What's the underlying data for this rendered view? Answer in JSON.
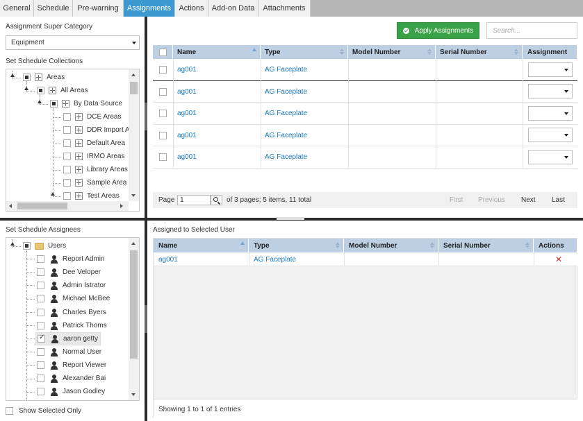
{
  "tabs": [
    {
      "label": "General",
      "active": false
    },
    {
      "label": "Schedule",
      "active": false
    },
    {
      "label": "Pre-warning",
      "active": false
    },
    {
      "label": "Assignments",
      "active": true
    },
    {
      "label": "Actions",
      "active": false
    },
    {
      "label": "Add-on Data",
      "active": false
    },
    {
      "label": "Attachments",
      "active": false
    }
  ],
  "left_top": {
    "super_category_label": "Assignment Super Category",
    "super_category_value": "Equipment",
    "collections_label": "Set Schedule Collections",
    "tree": [
      {
        "label": "Areas",
        "state": "partial",
        "icon": "grid-icon"
      },
      {
        "label": "All Areas",
        "state": "partial",
        "icon": "grid-icon"
      },
      {
        "label": "By Data Source",
        "state": "partial",
        "icon": "grid-icon"
      },
      {
        "label": "DCE Areas",
        "state": "unchecked",
        "icon": "grid-icon"
      },
      {
        "label": "DDR Import A",
        "state": "unchecked",
        "icon": "grid-icon"
      },
      {
        "label": "Default Area",
        "state": "unchecked",
        "icon": "grid-icon"
      },
      {
        "label": "IRMO Areas",
        "state": "unchecked",
        "icon": "grid-icon"
      },
      {
        "label": "Library Areas",
        "state": "unchecked",
        "icon": "grid-icon"
      },
      {
        "label": "Sample Area",
        "state": "unchecked",
        "icon": "grid-icon"
      },
      {
        "label": "Test Areas",
        "state": "unchecked",
        "icon": "grid-icon"
      }
    ]
  },
  "main_top": {
    "apply_button": "Apply Assignments",
    "search_placeholder": "Search...",
    "columns": [
      "Name",
      "Type",
      "Model Number",
      "Serial Number",
      "Assignment"
    ],
    "rows": [
      {
        "name": "ag001",
        "type": "AG Faceplate",
        "model": "",
        "serial": "",
        "assignment": ""
      },
      {
        "name": "ag001",
        "type": "AG Faceplate",
        "model": "",
        "serial": "",
        "assignment": ""
      },
      {
        "name": "ag001",
        "type": "AG Faceplate",
        "model": "",
        "serial": "",
        "assignment": ""
      },
      {
        "name": "ag001",
        "type": "AG Faceplate",
        "model": "",
        "serial": "",
        "assignment": ""
      },
      {
        "name": "ag001",
        "type": "AG Faceplate",
        "model": "",
        "serial": "",
        "assignment": ""
      }
    ],
    "pager": {
      "page_label": "Page",
      "page_value": "1",
      "summary": "of 3 pages; 5 items, 11 total",
      "first": "First",
      "previous": "Previous",
      "next": "Next",
      "last": "Last"
    }
  },
  "left_bottom": {
    "assignees_label": "Set Schedule Assignees",
    "root": {
      "label": "Users",
      "state": "partial",
      "icon": "folder-icon"
    },
    "users": [
      {
        "label": "Report Admin",
        "checked": false
      },
      {
        "label": "Dee Veloper",
        "checked": false
      },
      {
        "label": "Admin Istrator",
        "checked": false
      },
      {
        "label": "Michael McBee",
        "checked": false
      },
      {
        "label": "Charles Byers",
        "checked": false
      },
      {
        "label": "Patrick Thoms",
        "checked": false
      },
      {
        "label": "aaron getty",
        "checked": true
      },
      {
        "label": "Normal User",
        "checked": false
      },
      {
        "label": "Report Viewer",
        "checked": false
      },
      {
        "label": "Alexander Bai",
        "checked": false
      },
      {
        "label": "Jason Godley",
        "checked": false
      }
    ],
    "show_selected_label": "Show Selected Only"
  },
  "main_bottom": {
    "title": "Assigned to Selected User",
    "columns": [
      "Name",
      "Type",
      "Model Number",
      "Serial Number",
      "Actions"
    ],
    "rows": [
      {
        "name": "ag001",
        "type": "AG Faceplate",
        "model": "",
        "serial": ""
      }
    ],
    "footer": "Showing 1 to 1 of 1 entries"
  },
  "colors": {
    "tab_active": "#3d9ad1",
    "apply_button": "#3aa246",
    "grid_header": "#bdd0e3",
    "link": "#1a78c2",
    "delete": "#e03030"
  }
}
